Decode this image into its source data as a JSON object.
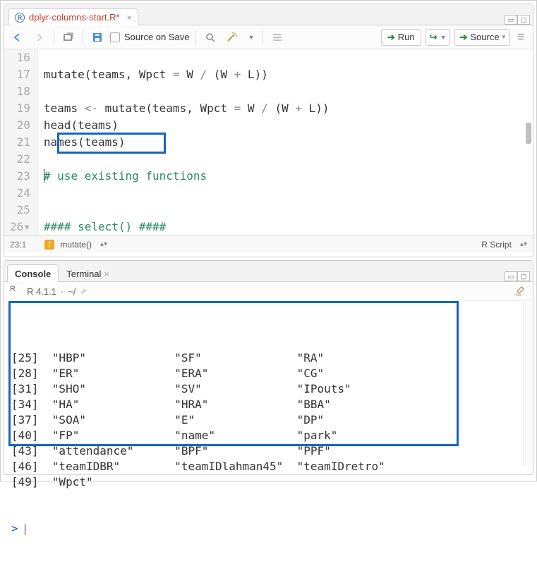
{
  "tabs": {
    "file": "dplyr-columns-start.R*"
  },
  "toolbar": {
    "source_on_save": "Source on Save",
    "run": "Run",
    "source": "Source"
  },
  "editor": {
    "lines": [
      {
        "n": 16,
        "t": ""
      },
      {
        "n": 17,
        "t": "mutate(teams, Wpct = W / (W + L))"
      },
      {
        "n": 18,
        "t": ""
      },
      {
        "n": 19,
        "t": "teams <- mutate(teams, Wpct = W / (W + L))"
      },
      {
        "n": 20,
        "t": "head(teams)"
      },
      {
        "n": 21,
        "t": "names(teams)"
      },
      {
        "n": 22,
        "t": ""
      },
      {
        "n": 23,
        "t": "# use existing functions",
        "comment": true,
        "cursor": true
      },
      {
        "n": 24,
        "t": ""
      },
      {
        "n": 25,
        "t": ""
      },
      {
        "n": 26,
        "t": "#### select() ####",
        "comment": true,
        "arrow": true
      }
    ],
    "highlight_line": 21
  },
  "status": {
    "cursor": "23:1",
    "fn": "mutate()",
    "lang": "R Script"
  },
  "console": {
    "tab_console": "Console",
    "tab_terminal": "Terminal",
    "version": "R 4.1.1",
    "path": "~/",
    "rows": [
      {
        "idx": "[25]",
        "c1": "\"HBP\"",
        "c2": "\"SF\"",
        "c3": "\"RA\""
      },
      {
        "idx": "[28]",
        "c1": "\"ER\"",
        "c2": "\"ERA\"",
        "c3": "\"CG\""
      },
      {
        "idx": "[31]",
        "c1": "\"SHO\"",
        "c2": "\"SV\"",
        "c3": "\"IPouts\""
      },
      {
        "idx": "[34]",
        "c1": "\"HA\"",
        "c2": "\"HRA\"",
        "c3": "\"BBA\""
      },
      {
        "idx": "[37]",
        "c1": "\"SOA\"",
        "c2": "\"E\"",
        "c3": "\"DP\""
      },
      {
        "idx": "[40]",
        "c1": "\"FP\"",
        "c2": "\"name\"",
        "c3": "\"park\""
      },
      {
        "idx": "[43]",
        "c1": "\"attendance\"",
        "c2": "\"BPF\"",
        "c3": "\"PPF\""
      },
      {
        "idx": "[46]",
        "c1": "\"teamIDBR\"",
        "c2": "\"teamIDlahman45\"",
        "c3": "\"teamIDretro\""
      },
      {
        "idx": "[49]",
        "c1": "\"Wpct\"",
        "c2": "",
        "c3": ""
      }
    ],
    "prompt": ">"
  }
}
